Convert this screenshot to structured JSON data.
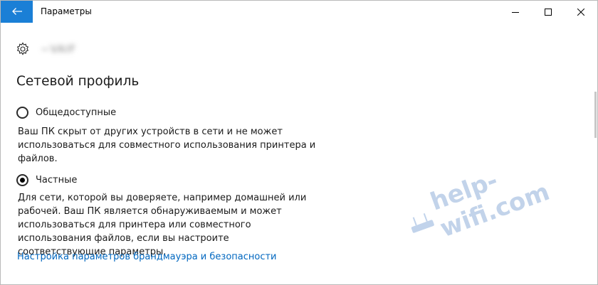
{
  "window": {
    "title": "Параметры",
    "back_icon": "arrow-left-icon",
    "accent_color": "#1a7fd6"
  },
  "header": {
    "icon": "gear-icon",
    "network_name": "~VAIF"
  },
  "section": {
    "title": "Сетевой профиль"
  },
  "profiles": [
    {
      "label": "Общедоступные",
      "selected": false,
      "description": "Ваш ПК скрыт от других устройств в сети и не может использоваться для совместного использования принтера и файлов."
    },
    {
      "label": "Частные",
      "selected": true,
      "description": "Для сети, которой вы доверяете, например домашней или рабочей. Ваш ПК является обнаруживаемым и может использоваться для принтера или совместного использования файлов, если вы настроите соответствующие параметры."
    }
  ],
  "link": {
    "text": "Настройка параметров брандмауэра и безопасности",
    "color": "#0067c0"
  },
  "watermark": {
    "text": "help-wifi.com"
  }
}
